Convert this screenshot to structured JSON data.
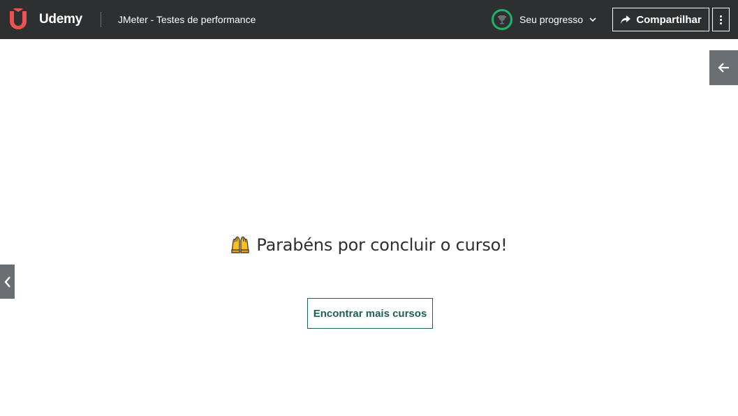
{
  "header": {
    "logo_text": "Udemy",
    "course_title": "JMeter - Testes de performance",
    "progress_label": "Seu progresso",
    "share_label": "Compartilhar",
    "colors": {
      "background": "#2d2f31",
      "logo_accent": "#ec5252",
      "progress_ring": "#1eb36b"
    },
    "icons": {
      "progress": "trophy-icon",
      "dropdown": "chevron-down-icon",
      "share": "share-arrow-icon",
      "more": "more-vertical-icon"
    }
  },
  "main": {
    "congrats_emoji": "raising-hands-emoji",
    "congrats_text": "Parabéns por concluir o curso!",
    "find_courses_label": "Encontrar mais cursos",
    "accent_color": "#1e6055"
  },
  "navigation": {
    "sidebar_toggle_icon": "arrow-left-icon",
    "previous_icon": "chevron-left-icon"
  }
}
